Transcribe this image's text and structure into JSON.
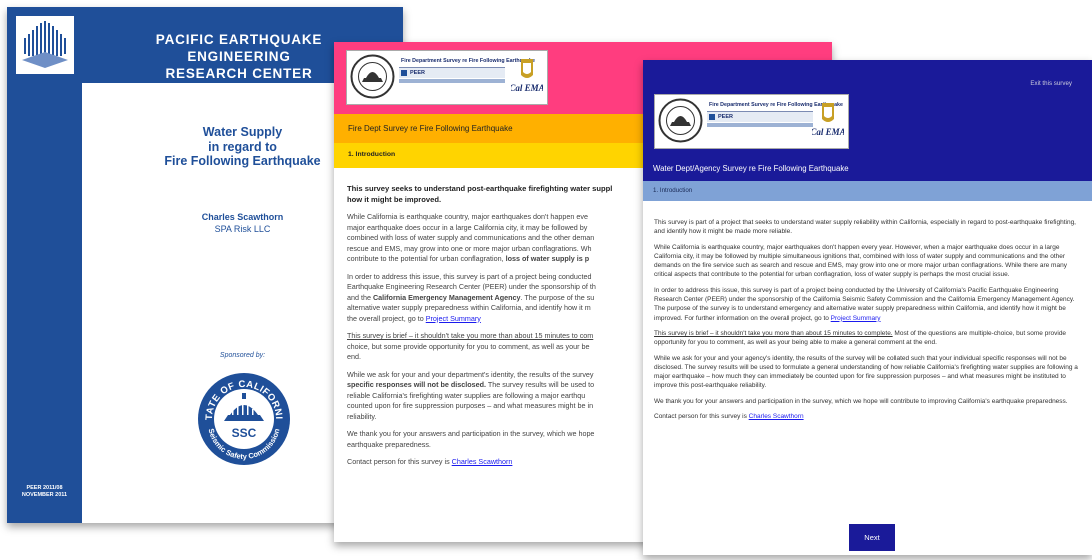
{
  "cover": {
    "org_line1": "PACIFIC EARTHQUAKE ENGINEERING",
    "org_line2": "RESEARCH CENTER",
    "title_line1": "Water Supply",
    "title_line2": "in regard to",
    "title_line3": "Fire Following Earthquake",
    "author": "Charles Scawthorn",
    "affiliation": "SPA Risk LLC",
    "sponsored_by": "Sponsored by:",
    "seal_top_text": "STATE OF CALIFORNIA",
    "seal_bottom_text": "Seismic Safety Commission",
    "seal_center": "SSC",
    "report_number": "PEER 2011/08",
    "report_date": "NOVEMBER 2011"
  },
  "logo": {
    "title": "Fire Department Survey re Fire Following Earthquake",
    "peer": "PEER",
    "calema": "Cal EMA"
  },
  "fire": {
    "title": "Fire Dept Survey re Fire Following Earthquake",
    "section": "1. Introduction",
    "p1": "This survey seeks to understand post-earthquake firefighting water suppl",
    "p1b": "how it might be improved.",
    "p2a": "While California is earthquake country, major earthquakes don't happen eve",
    "p2b": "major earthquake does occur in a large California city, it may be followed by",
    "p2c": "combined with loss of water supply and communications and the other deman",
    "p2d": "rescue and EMS, may grow into one or more major urban conflagrations. Wh",
    "p2e": "contribute to the potential for urban conflagration, ",
    "p2e_bold": "loss of water supply is p",
    "p3a": "In order to address this issue, this survey is part of a project being conducted",
    "p3b": "Earthquake Engineering Research Center (PEER) under the sponsorship of th",
    "p3c_pre": "and the ",
    "p3c_bold": "California Emergency Management Agency",
    "p3c_post": ". The purpose of the su",
    "p3d": "alternative water supply preparedness within California, and identify how it m",
    "p3e": "the overall project, go to ",
    "p3_link": "Project Summary",
    "p4a_ul": "This survey is brief – it shouldn't take you more than about 15 minutes to com",
    "p4b": "choice, but some provide opportunity for you to comment, as well as your be",
    "p4c": "end.",
    "p5a": "While we ask for your and your department's identity, the results of the survey",
    "p5b_bold": "specific responses will not be disclosed.",
    "p5b_post": " The survey results will be used to",
    "p5c": "reliable California's firefighting water supplies are following a major earthqu",
    "p5d": "counted upon for fire suppression purposes – and what measures might be in",
    "p5e": "reliability.",
    "p6a": "We thank you for your answers and participation in the survey, which we hope",
    "p6b": "earthquake preparedness.",
    "p7": "Contact person for this survey is ",
    "p7_link": "Charles Scawthorn"
  },
  "water": {
    "exit": "Exit this survey",
    "title": "Water Dept/Agency Survey re Fire Following Earthquake",
    "section": "1. Introduction",
    "p1": "This survey is part of a project that seeks to understand water supply reliability within California, especially in regard to post-earthquake firefighting, and identify how it might be made more reliable.",
    "p2": "While California is earthquake country, major earthquakes don't happen every year. However, when a major earthquake does occur in a large California city, it may be followed by multiple simultaneous ignitions that, combined with loss of water supply and communications and the other demands on the fire service such as search and rescue and EMS, may grow into one or more major urban conflagrations. While there are many critical aspects that contribute to the potential for urban conflagration, loss of water supply is perhaps the most crucial issue.",
    "p3": "In order to address this issue, this survey is part of a project being conducted by the University of California's Pacific Earthquake Engineering Research Center (PEER) under the sponsorship of the California Seismic Safety Commission and the California Emergency Management Agency. The purpose of the survey is to understand emergency and alternative water supply preparedness within California, and identify how it might be improved. For further information on the overall project, go to ",
    "p3_link": "Project Summary",
    "p4_ul": "This survey is brief – it shouldn't take you more than about 15 minutes to complete.",
    "p4_rest": " Most of the questions are multiple-choice, but some provide opportunity for you to comment, as well as your being able to make a general comment at the end.",
    "p5": "While we ask for your and your agency's identity, the results of the survey will be collated such that your individual specific responses will not be disclosed. The survey results will be used to formulate a general understanding of how reliable California's firefighting water supplies are following a major earthquake – how much they can immediately be counted upon for fire suppression purposes – and what measures might be instituted to improve this post-earthquake reliability.",
    "p6": "We thank you for your answers and participation in the survey, which we hope will contribute to improving California's earthquake preparedness.",
    "p7": "Contact person for this survey is ",
    "p7_link": "Charles Scawthorn",
    "next": "Next"
  }
}
